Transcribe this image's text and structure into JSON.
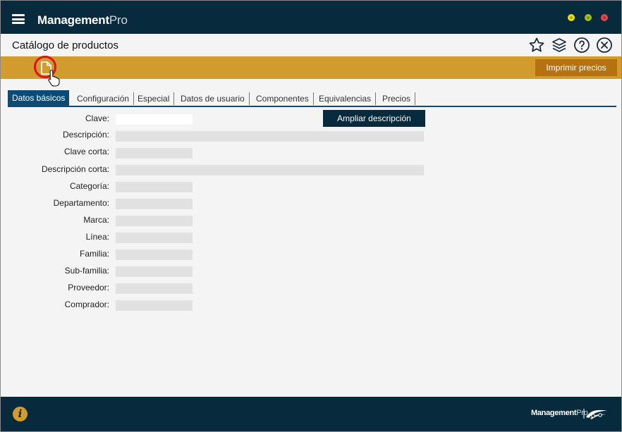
{
  "app": {
    "brand_bold": "Management",
    "brand_light": "Pro"
  },
  "header": {
    "title": "Catálogo de productos"
  },
  "toolbar": {
    "print_label": "Imprimir precios"
  },
  "tabs": [
    {
      "label": "Datos básicos",
      "active": true
    },
    {
      "label": "Configuración"
    },
    {
      "label": "Especial"
    },
    {
      "label": "Datos de usuario"
    },
    {
      "label": "Componentes"
    },
    {
      "label": "Equivalencias"
    },
    {
      "label": "Precios"
    }
  ],
  "form": {
    "expand_label": "Ampliar descripción",
    "fields": [
      {
        "label": "Clave:",
        "value": ""
      },
      {
        "label": "Descripción:",
        "value": ""
      },
      {
        "label": "Clave corta:",
        "value": ""
      },
      {
        "label": "Descripción corta:",
        "value": ""
      },
      {
        "label": "Categoría:",
        "value": ""
      },
      {
        "label": "Departamento:",
        "value": ""
      },
      {
        "label": "Marca:",
        "value": ""
      },
      {
        "label": "Línea:",
        "value": ""
      },
      {
        "label": "Familia:",
        "value": ""
      },
      {
        "label": "Sub-familia:",
        "value": ""
      },
      {
        "label": "Proveedor:",
        "value": ""
      },
      {
        "label": "Comprador:",
        "value": ""
      }
    ]
  },
  "footer": {
    "brand_bold": "Management",
    "brand_light": "Pro",
    "info_glyph": "i"
  },
  "icons": {
    "menu": "hamburger-icon",
    "favorite": "star-icon",
    "layers": "layers-icon",
    "help": "help-icon",
    "close": "close-circle-icon",
    "new": "new-document-icon",
    "cursor": "pointer-hand-icon",
    "info": "info-icon"
  },
  "colors": {
    "titlebar": "#072a3c",
    "toolbar": "#d19b2d",
    "print_button": "#b67211",
    "tab_active": "#0b4b78",
    "field": "#e1e1e1",
    "highlight": "#e0101a",
    "win_minimize": "#e8e300",
    "win_maximize": "#9fc31c",
    "win_close": "#e3474b"
  }
}
